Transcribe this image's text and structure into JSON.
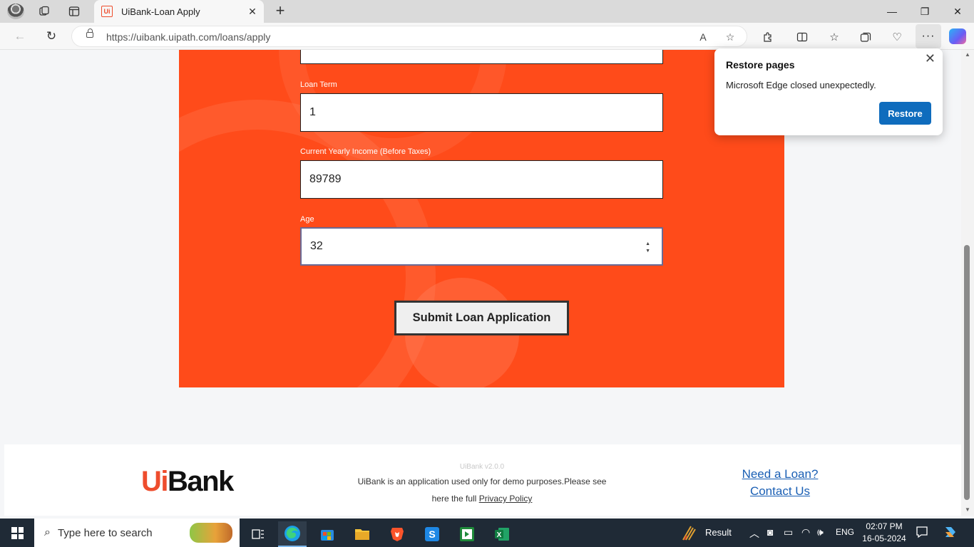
{
  "browser": {
    "tab_title": "UiBank-Loan Apply",
    "tab_favicon_text": "Ui",
    "url": "https://uibank.uipath.com/loans/apply",
    "icons": [
      "profile-icon",
      "workspaces-icon",
      "tab-actions-icon",
      "close-icon",
      "new-tab-icon",
      "back-icon",
      "refresh-icon",
      "lock-icon",
      "read-aloud-icon",
      "favorite-icon",
      "extensions-icon",
      "split-screen-icon",
      "favorites-icon",
      "collections-icon",
      "browser-essentials-icon",
      "more-icon",
      "copilot-icon"
    ]
  },
  "form": {
    "loan_term_label": "Loan Term",
    "loan_term_value": "1",
    "income_label": "Current Yearly Income (Before Taxes)",
    "income_value": "89789",
    "age_label": "Age",
    "age_value": "32",
    "submit_label": "Submit Loan Application",
    "accent_color": "#ff4b1a"
  },
  "footer": {
    "logo_ui": "Ui",
    "logo_bank": "Bank",
    "version": "UiBank v2.0.0",
    "description": "UiBank is an application used only for demo purposes.Please see",
    "privacy_prefix": "here the full",
    "privacy_link": "Privacy Policy",
    "need_loan": "Need a Loan?",
    "contact_us": "Contact Us"
  },
  "popup": {
    "title": "Restore pages",
    "message": "Microsoft Edge closed unexpectedly.",
    "button": "Restore",
    "button_color": "#0f6cbd"
  },
  "taskbar": {
    "search_placeholder": "Type here to search",
    "result_label": "Result",
    "language": "ENG",
    "time": "02:07 PM",
    "date": "16-05-2024"
  }
}
